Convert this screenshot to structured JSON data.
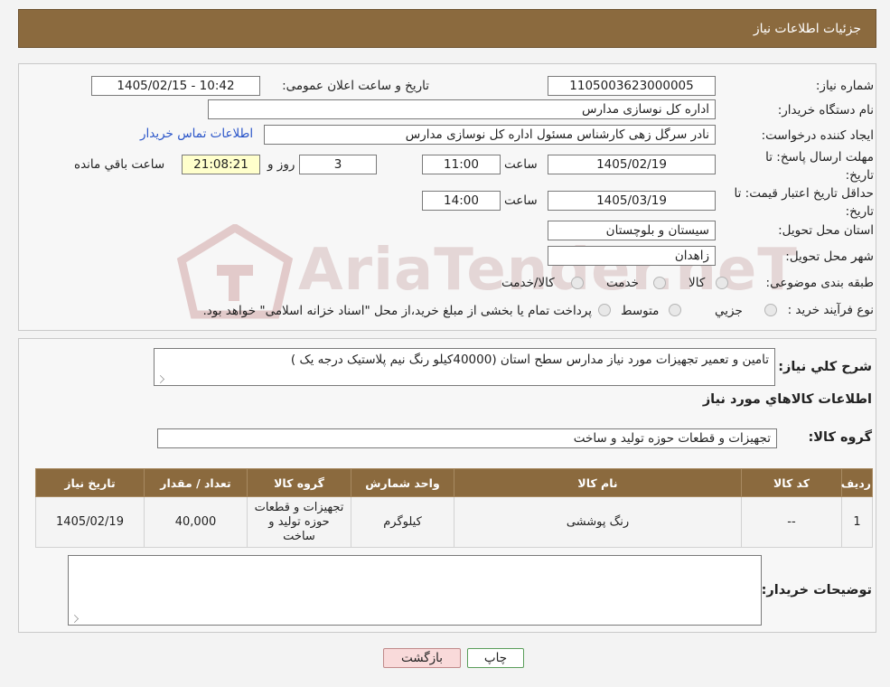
{
  "header": {
    "title": "جزئیات اطلاعات نیاز"
  },
  "form": {
    "need_number_label": "شماره نیاز:",
    "need_number": "1105003623000005",
    "announce_label": "تاریخ و ساعت اعلان عمومی:",
    "announce_value": "1405/02/15 - 10:42",
    "buyer_org_label": "نام دستگاه خریدار:",
    "buyer_org": "اداره کل نوسازی مدارس",
    "creator_label": "ایجاد کننده درخواست:",
    "creator": "نادر سرگل زهی کارشناس مسئول اداره کل نوسازی مدارس",
    "contact_link": "اطلاعات تماس خریدار",
    "deadline_label": "مهلت ارسال پاسخ: تا تاریخ:",
    "deadline_date": "1405/02/19",
    "time_label": "ساعت",
    "deadline_time": "11:00",
    "days": "3",
    "days_label": "روز و",
    "remaining": "21:08:21",
    "remaining_label": "ساعت باقي مانده",
    "validity_label": "حداقل تاریخ اعتبار قیمت: تا تاریخ:",
    "validity_date": "1405/03/19",
    "validity_time": "14:00",
    "province_label": "استان محل تحویل:",
    "province": "سیستان و بلوچستان",
    "city_label": "شهر محل تحویل:",
    "city": "زاهدان",
    "category_label": "طبقه بندی موضوعی:",
    "category_options": [
      "کالا",
      "خدمت",
      "کالا/خدمت"
    ],
    "process_label": "نوع فرآیند خرید :",
    "process_options": [
      "جزيي",
      "متوسط"
    ],
    "process_note": "پرداخت تمام یا بخشی از مبلغ خرید،از محل \"اسناد خزانه اسلامی\" خواهد بود."
  },
  "description": {
    "label": "شرح کلي نياز:",
    "text": "تامین و تعمیر تجهیزات مورد نیاز مدارس سطح استان (40000کیلو رنگ نیم پلاستیک درجه یک )",
    "items_title": "اطلاعات کالاهاي مورد نياز",
    "group_label": "گروه کالا:",
    "group_value": "تجهیزات و قطعات حوزه تولید و ساخت"
  },
  "table": {
    "headers": [
      "ردیف",
      "کد کالا",
      "نام کالا",
      "واحد شمارش",
      "گروه کالا",
      "تعداد / مقدار",
      "تاریخ نیاز"
    ],
    "rows": [
      [
        "1",
        "--",
        "رنگ پوششی",
        "کیلوگرم",
        "تجهیزات و قطعات حوزه تولید و ساخت",
        "40,000",
        "1405/02/19"
      ]
    ]
  },
  "buyer_notes": {
    "label": "توضیحات خریدار:",
    "value": ""
  },
  "buttons": {
    "print": "چاپ",
    "back": "بازگشت"
  },
  "watermark": {
    "text": "AriaTender.neT"
  },
  "colors": {
    "header_brown": "#8b6a3e",
    "link_blue": "#2a55c9",
    "back_pink": "#f9dada",
    "print_green_border": "#5a9e5a"
  }
}
